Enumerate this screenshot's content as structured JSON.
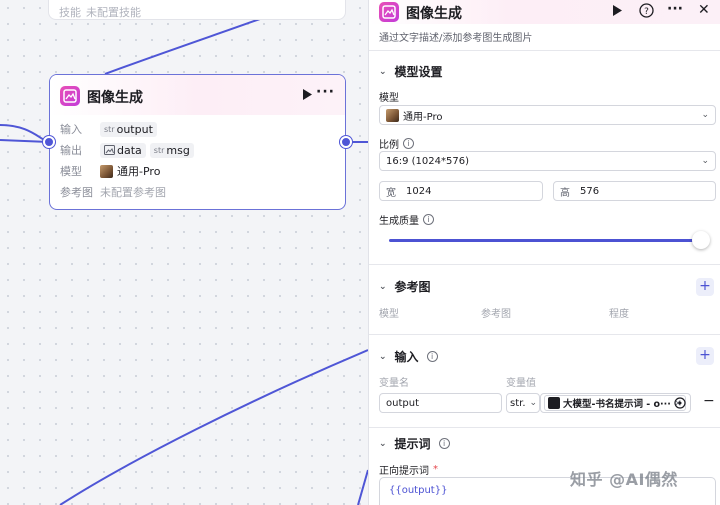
{
  "canvas": {
    "top_node": {
      "label": "技能",
      "value": "未配置技能"
    },
    "node": {
      "title": "图像生成",
      "rows": {
        "input_label": "输入",
        "input_tag_type": "str",
        "input_tag": "output",
        "output_label": "输出",
        "output_tag1": "data",
        "output_tag2_type": "str",
        "output_tag2": "msg",
        "model_label": "模型",
        "model_value": "通用-Pro",
        "ref_label": "参考图",
        "ref_value": "未配置参考图"
      }
    }
  },
  "panel": {
    "title": "图像生成",
    "description": "通过文字描述/添加参考图生成图片",
    "model_section": {
      "title": "模型设置",
      "model_label": "模型",
      "model_value": "通用-Pro",
      "ratio_label": "比例",
      "ratio_value": "16:9 (1024*576)",
      "width_prefix": "宽",
      "width_value": "1024",
      "height_prefix": "高",
      "height_value": "576",
      "quality_label": "生成质量",
      "quality_level": 1.0
    },
    "ref_section": {
      "title": "参考图",
      "columns": [
        "模型",
        "参考图",
        "程度"
      ]
    },
    "input_section": {
      "title": "输入",
      "col_name": "变量名",
      "col_value": "变量值",
      "var_name": "output",
      "var_type": "str.",
      "var_ref": "大模型-书名提示词 - o···"
    },
    "prompt_section": {
      "title": "提示词",
      "positive_label": "正向提示词",
      "positive_value": "{{output}}"
    }
  },
  "watermark": "知乎 @AI偶然",
  "colors": {
    "accent": "#4c52d3",
    "node_border": "#6b72d8",
    "icon_pink": "#e94fb5"
  }
}
